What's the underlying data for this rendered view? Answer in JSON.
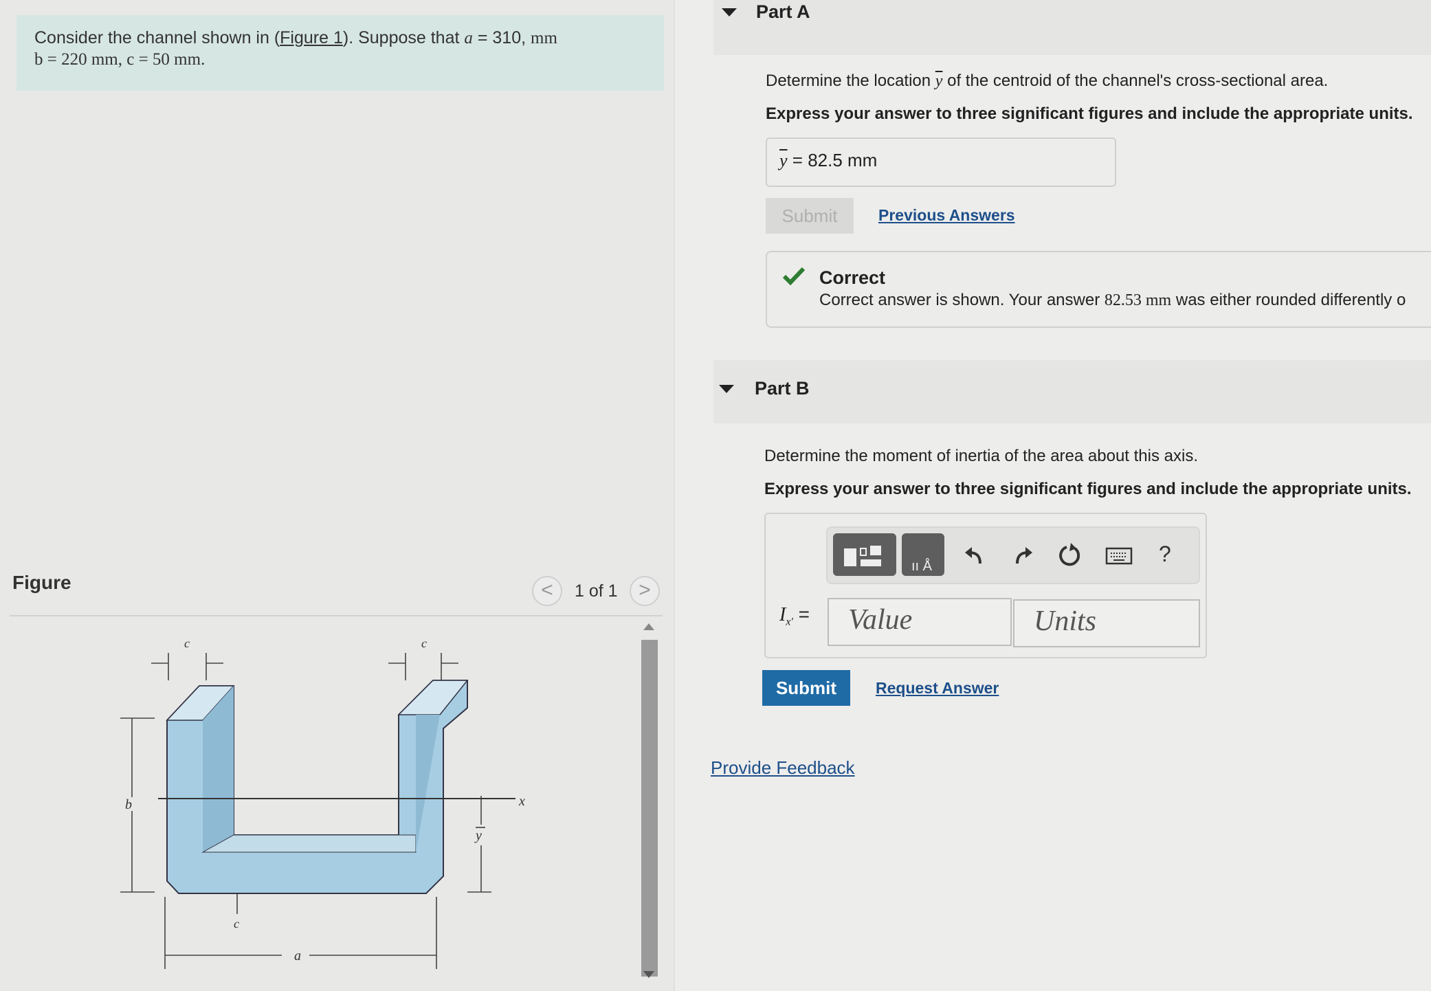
{
  "problem": {
    "text_before": "Consider the channel shown in (",
    "figure_link": "Figure 1",
    "text_after": "). Suppose that ",
    "var_a": "a",
    "eq_a": " = 310, ",
    "unit_a": "mm",
    "line2": "b = 220 mm, c = 50 mm."
  },
  "figure": {
    "title": "Figure",
    "pager": "1 of 1",
    "prev": "<",
    "next": ">",
    "labels": {
      "c": "c",
      "b": "b",
      "a": "a",
      "x": "x",
      "ybar": "y"
    }
  },
  "partA": {
    "title": "Part A",
    "question_pre": "Determine the location ",
    "question_var": "y",
    "question_post": " of the centroid of the channel's cross-sectional area.",
    "instruction": "Express your answer to three significant figures and include the appropriate units.",
    "answer_label": "y",
    "answer_eq": " = ",
    "answer_value": "82.5 mm",
    "submit": "Submit",
    "previous_answers": "Previous Answers",
    "feedback_title": "Correct",
    "feedback_pre": "Correct answer is shown. Your answer ",
    "feedback_value": "82.53 mm",
    "feedback_post": " was either rounded differently o"
  },
  "partB": {
    "title": "Part B",
    "question": "Determine the moment of inertia of the area about this axis.",
    "instruction": "Express your answer to three significant figures and include the appropriate units.",
    "input_label": "I",
    "input_sub": "x'",
    "input_eq": " =",
    "value_placeholder": "Value",
    "units_placeholder": "Units",
    "submit": "Submit",
    "request_answer": "Request Answer",
    "toolbar": [
      "templates-icon",
      "units-icon",
      "undo-icon",
      "redo-icon",
      "reset-icon",
      "keyboard-icon",
      "help-icon"
    ],
    "help": "?"
  },
  "provide_feedback": "Provide Feedback",
  "colors": {
    "problem_bg": "#d6e6e3",
    "submit_blue": "#1f6ba5",
    "link_blue": "#1d4f8a",
    "check_green": "#2e7d32"
  }
}
